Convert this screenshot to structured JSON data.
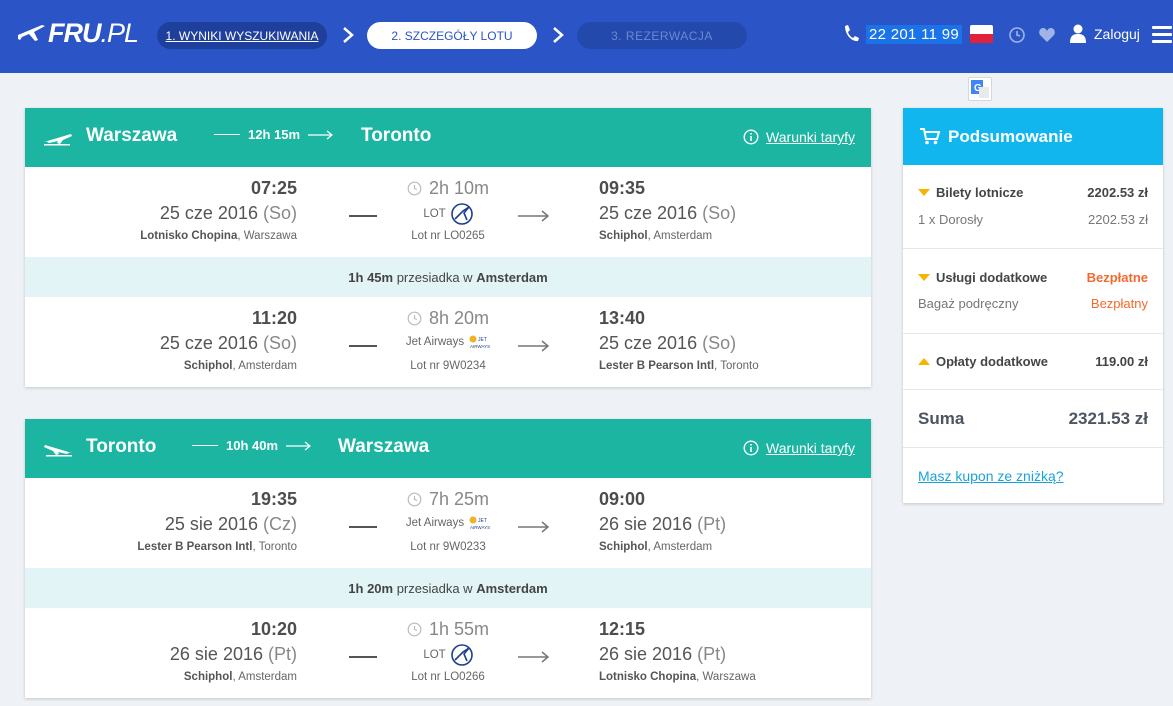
{
  "header": {
    "logo_main": "FRU",
    "logo_suffix": ".PL",
    "steps": [
      {
        "label": "1. WYNIKI WYSZUKIWANIA"
      },
      {
        "label": "2. SZCZEGÓŁY LOTU"
      },
      {
        "label": "3. REZERWACJA"
      }
    ],
    "phone": "22 201 11 99",
    "login_label": "Zaloguj",
    "icons": [
      "phone-icon",
      "flag-pl-icon",
      "history-icon",
      "heart-icon",
      "user-icon",
      "menu-icon",
      "translate-icon"
    ]
  },
  "flights": [
    {
      "from_city": "Warszawa",
      "to_city": "Toronto",
      "total_duration": "12h 15m",
      "terms_label": "Warunki taryfy",
      "segments": [
        {
          "dep_time": "07:25",
          "dep_date": "25 cze 2016",
          "dep_dow": "(So)",
          "dep_airport": "Lotnisko Chopina",
          "dep_city": ", Warszawa",
          "duration": "2h 10m",
          "airline": "LOT",
          "airline_logo": "lot",
          "flight_no": "Lot nr LO0265",
          "arr_time": "09:35",
          "arr_date": "25 cze 2016",
          "arr_dow": "(So)",
          "arr_airport": "Schiphol",
          "arr_city": ",  Amsterdam"
        },
        {
          "dep_time": "11:20",
          "dep_date": "25 cze 2016",
          "dep_dow": "(So)",
          "dep_airport": "Schiphol",
          "dep_city": ", Amsterdam",
          "duration": "8h 20m",
          "airline": "Jet Airways",
          "airline_logo": "jet",
          "flight_no": "Lot nr 9W0234",
          "arr_time": "13:40",
          "arr_date": "25 cze 2016",
          "arr_dow": "(So)",
          "arr_airport": "Lester B Pearson Intl",
          "arr_city": ",  Toronto"
        }
      ],
      "layover": {
        "duration": "1h 45m",
        "text": " przesiadka w ",
        "city": "Amsterdam"
      }
    },
    {
      "from_city": "Toronto",
      "to_city": "Warszawa",
      "total_duration": "10h 40m",
      "terms_label": "Warunki taryfy",
      "segments": [
        {
          "dep_time": "19:35",
          "dep_date": "25 sie 2016",
          "dep_dow": "(Cz)",
          "dep_airport": "Lester B Pearson Intl",
          "dep_city": ", Toronto",
          "duration": "7h 25m",
          "airline": "Jet Airways",
          "airline_logo": "jet",
          "flight_no": "Lot nr 9W0233",
          "arr_time": "09:00",
          "arr_date": "26 sie 2016",
          "arr_dow": "(Pt)",
          "arr_airport": "Schiphol",
          "arr_city": ",  Amsterdam"
        },
        {
          "dep_time": "10:20",
          "dep_date": "26 sie 2016",
          "dep_dow": "(Pt)",
          "dep_airport": "Schiphol",
          "dep_city": ", Amsterdam",
          "duration": "1h 55m",
          "airline": "LOT",
          "airline_logo": "lot",
          "flight_no": "Lot nr LO0266",
          "arr_time": "12:15",
          "arr_date": "26 sie 2016",
          "arr_dow": "(Pt)",
          "arr_airport": "Lotnisko Chopina",
          "arr_city": ",  Warszawa"
        }
      ],
      "layover": {
        "duration": "1h 20m",
        "text": " przesiadka w ",
        "city": "Amsterdam"
      }
    }
  ],
  "summary": {
    "title": "Podsumowanie",
    "tickets_label": "Bilety lotnicze",
    "tickets_value": "2202.53 zł",
    "passengers_label": "1 x Dorosły",
    "passengers_value": "2202.53 zł",
    "services_label": "Usługi dodatkowe",
    "services_value": "Bezpłatne",
    "baggage_label": "Bagaż podręczny",
    "baggage_value": "Bezpłatny",
    "fees_label": "Opłaty dodatkowe",
    "fees_value": "119.00 zł",
    "total_label": "Suma",
    "total_value": "2321.53 zł",
    "coupon_label": "Masz kupon ze zniżką?"
  }
}
